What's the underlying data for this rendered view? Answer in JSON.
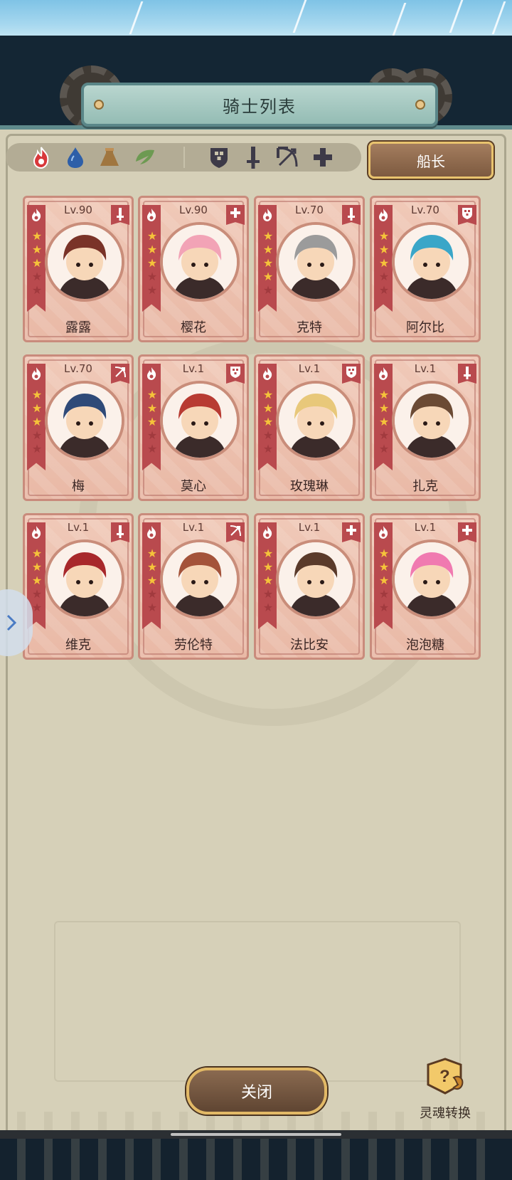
{
  "title": "骑士列表",
  "captain_label": "船长",
  "close_label": "关闭",
  "soul_convert_label": "灵魂转换",
  "filters": {
    "elements": [
      "fire-element-icon",
      "water-element-icon",
      "earth-element-icon",
      "wind-element-icon"
    ],
    "classes": [
      "tank-class-icon",
      "warrior-class-icon",
      "ranger-class-icon",
      "support-class-icon"
    ]
  },
  "knights": [
    {
      "level": "Lv.90",
      "name": "露露",
      "stars": 3,
      "class_icon": "sword",
      "portrait": "#7a3328"
    },
    {
      "level": "Lv.90",
      "name": "樱花",
      "stars": 3,
      "class_icon": "plus",
      "portrait": "#f2a3b6"
    },
    {
      "level": "Lv.70",
      "name": "克特",
      "stars": 4,
      "class_icon": "sword",
      "portrait": "#9b9b9b"
    },
    {
      "level": "Lv.70",
      "name": "阿尔比",
      "stars": 3,
      "class_icon": "shield",
      "portrait": "#3aa6c8"
    },
    {
      "level": "Lv.70",
      "name": "梅",
      "stars": 3,
      "class_icon": "bow",
      "portrait": "#2f4a78"
    },
    {
      "level": "Lv.1",
      "name": "莫心",
      "stars": 3,
      "class_icon": "shield",
      "portrait": "#b83b32"
    },
    {
      "level": "Lv.1",
      "name": "玫瑰琳",
      "stars": 3,
      "class_icon": "shield",
      "portrait": "#e8c87a"
    },
    {
      "level": "Lv.1",
      "name": "扎克",
      "stars": 3,
      "class_icon": "sword",
      "portrait": "#6b4a34"
    },
    {
      "level": "Lv.1",
      "name": "维克",
      "stars": 3,
      "class_icon": "sword",
      "portrait": "#a8282b"
    },
    {
      "level": "Lv.1",
      "name": "劳伦特",
      "stars": 3,
      "class_icon": "bow",
      "portrait": "#a4533a"
    },
    {
      "level": "Lv.1",
      "name": "法比安",
      "stars": 3,
      "class_icon": "plus",
      "portrait": "#5a3a2a"
    },
    {
      "level": "Lv.1",
      "name": "泡泡糖",
      "stars": 3,
      "class_icon": "plus",
      "portrait": "#f07ab0"
    }
  ],
  "colors": {
    "card_bg": "#f0c9b8",
    "ribbon": "#b94a4e",
    "panel": "#d6d0b8",
    "accent_gold": "#e9c36e"
  }
}
